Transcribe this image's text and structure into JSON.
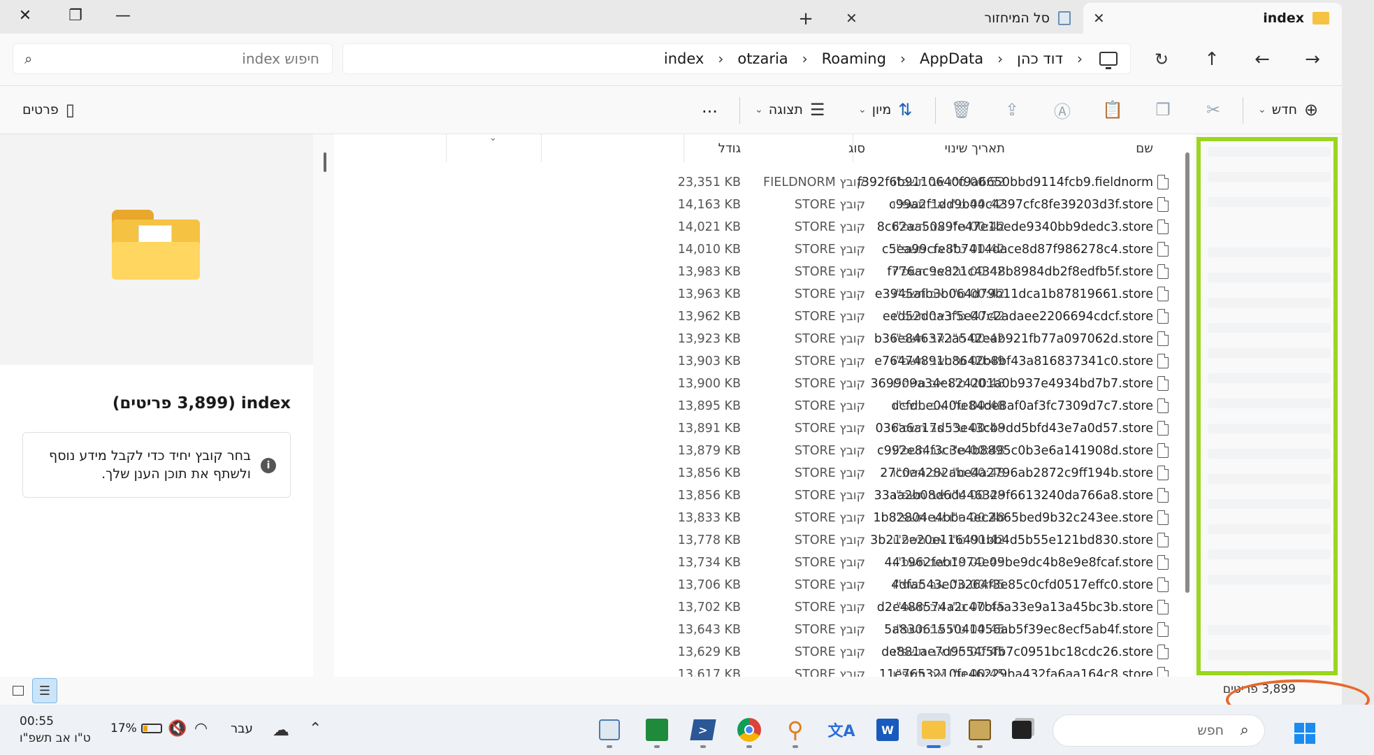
{
  "tabs": [
    {
      "label": "index",
      "active": true,
      "icon": "folder-icon"
    },
    {
      "label": "סל המיחזור",
      "active": false,
      "icon": "recycle-bin-icon"
    }
  ],
  "window_controls": {
    "close": "✕",
    "restore": "❐",
    "minimize": "—"
  },
  "search": {
    "placeholder": "חיפוש index"
  },
  "breadcrumb": [
    "דוד כהן",
    "AppData",
    "Roaming",
    "otzaria",
    "index"
  ],
  "toolbar": {
    "new_label": "חדש",
    "sort_label": "מיון",
    "view_label": "תצוגה",
    "more_label": "...",
    "details_label": "פרטים"
  },
  "columns": {
    "name": "שם",
    "date": "תאריך שינוי",
    "type": "סוג",
    "size": "גודל"
  },
  "files": [
    {
      "name": "f392f6b9110640f9a6650bbd9114fcb9.fieldnorm",
      "date": "00:52 ט\"ו אב תשפ\"ו",
      "type": "קובץ FIELDNORM",
      "size": "23,351 KB"
    },
    {
      "name": "c99a2f1dd9b44c4397cfc8fe39203d3f.store",
      "date": "00:42 ט\"ו אב תשפ\"ו",
      "type": "קובץ STORE",
      "size": "14,163 KB"
    },
    {
      "name": "8c62aa5089fe47e1bede9340bb9dedc3.store",
      "date": "00:42 ט\"ו אב תשפ\"ו",
      "type": "קובץ STORE",
      "size": "14,021 KB"
    },
    {
      "name": "c5ea99cfe8b7414dace8d87f986278c4.store",
      "date": "00:42 ט\"ו אב תשפ\"ו",
      "type": "קובץ STORE",
      "size": "14,010 KB"
    },
    {
      "name": "f776ac9e821c4348b8984db2f8edfb5f.store",
      "date": "00:42 ט\"ו אב תשפ\"ו",
      "type": "קובץ STORE",
      "size": "13,983 KB"
    },
    {
      "name": "e3945afb3b064d79b11dca1b87819661.store",
      "date": "00:42 ט\"ו אב תשפ\"ו",
      "type": "קובץ STORE",
      "size": "13,963 KB"
    },
    {
      "name": "eed52d0a3f5e47c2adaee2206694cdcf.store",
      "date": "00:42 ט\"ו אב תשפ\"ו",
      "type": "קובץ STORE",
      "size": "13,962 KB"
    },
    {
      "name": "b36e846372a542eab921fb77a097062d.store",
      "date": "00:42 ט\"ו אב תשפ\"ו",
      "type": "קובץ STORE",
      "size": "13,923 KB"
    },
    {
      "name": "e76474891b8642b8bf43a816837341c0.store",
      "date": "00:49 ט\"ו אב תשפ\"ו",
      "type": "קובץ STORE",
      "size": "13,903 KB"
    },
    {
      "name": "369909a34e824201a0b937e4934bd7b7.store",
      "date": "00:48 ט\"ו אב תשפ\"ו",
      "type": "קובץ STORE",
      "size": "13,900 KB"
    },
    {
      "name": "dcfdbe040fe84de8af0af3fc7309d7c7.store",
      "date": "00:48 ט\"ו אב תשפ\"ו",
      "type": "קובץ STORE",
      "size": "13,895 KB"
    },
    {
      "name": "036a6a17d53e43cb9dd5bfd43e7a0d57.store",
      "date": "00:48 ט\"ו אב תשפ\"ו",
      "type": "קובץ STORE",
      "size": "13,891 KB"
    },
    {
      "name": "c992e84f3c3e4b8895c0b3e6a141908d.store",
      "date": "00:48 ט\"ו אב תשפ\"ו",
      "type": "קובץ STORE",
      "size": "13,879 KB"
    },
    {
      "name": "27c0a4282abe4a2796ab2872c9ff194b.store",
      "date": "00:48 ט\"ו אב תשפ\"ו",
      "type": "קובץ STORE",
      "size": "13,856 KB"
    },
    {
      "name": "33aa2b08d6d446329f6613240da766a8.store",
      "date": "00:48 ט\"ו אב תשפ\"ו",
      "type": "קובץ STORE",
      "size": "13,856 KB"
    },
    {
      "name": "1b82804e4bba4ec2b65bed9b32c243ee.store",
      "date": "00:48 ט\"ו אב תשפ\"ו",
      "type": "קובץ STORE",
      "size": "13,833 KB"
    },
    {
      "name": "3b212e20e116491bb4d5b55e121bd830.store",
      "date": "00:42 ט\"ו אב תשפ\"ו",
      "type": "קובץ STORE",
      "size": "13,778 KB"
    },
    {
      "name": "441962feb1974e09be9dc4b8e9e8fcaf.store",
      "date": "00:45 ט\"ו אב תשפ\"ו",
      "type": "קובץ STORE",
      "size": "13,734 KB"
    },
    {
      "name": "4dfa543e03264f3e85c0cfd0517effc0.store",
      "date": "00:45 ט\"ו אב תשפ\"ו",
      "type": "קובץ STORE",
      "size": "13,706 KB"
    },
    {
      "name": "d2e488574a2c47bfaa33e9a13a45bc3b.store",
      "date": "00:45 ט\"ו אב תשפ\"ו",
      "type": "קובץ STORE",
      "size": "13,702 KB"
    },
    {
      "name": "5a8306155041456ab5f39ec8ecf5ab4f.store",
      "date": "00:45 ט\"ו אב תשפ\"ו",
      "type": "קובץ STORE",
      "size": "13,643 KB"
    },
    {
      "name": "de881ae7d9554f5fb7c0951bc18cdc26.store",
      "date": "00:45 ט\"ו אב תשפ\"ו",
      "type": "קובץ STORE",
      "size": "13,629 KB"
    },
    {
      "name": "11e7653210fe46229ba432fa6aa164c8.store",
      "date": "00:45 ט\"ו אב תשפ\"ו",
      "type": "קובץ STORE",
      "size": "13,617 KB"
    }
  ],
  "details_pane": {
    "title": "index (3,899 פריטים)",
    "info_text": "בחר קובץ יחיד כדי לקבל מידע נוסף ולשתף את תוכן הענן שלך."
  },
  "status": {
    "item_count": "3,899 פריטים"
  },
  "taskbar": {
    "time": "00:55",
    "date": "ט\"ו אב תשפ\"ו",
    "battery": "17%",
    "language": "עבר",
    "search_placeholder": "חפש"
  },
  "colors": {
    "highlight_box": "#9bd61e",
    "annotation_ellipse": "#e8672a",
    "accent": "#1a5fb4"
  }
}
